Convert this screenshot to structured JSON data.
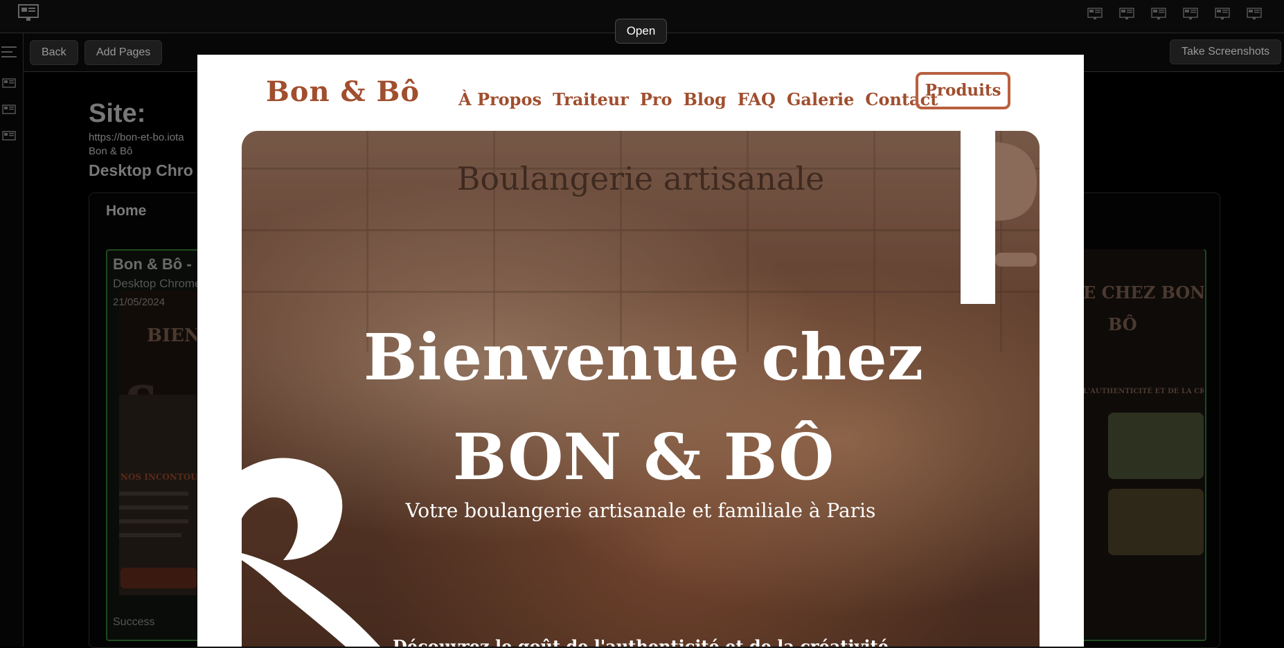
{
  "toolbar": {
    "back": "Back",
    "add_pages": "Add Pages",
    "take_screenshots": "Take Screenshots"
  },
  "site": {
    "heading": "Site:",
    "url": "https://bon-et-bo.iota",
    "name": "Bon & Bô",
    "device": "Desktop Chro"
  },
  "panel": {
    "title": "Home",
    "card": {
      "title": "Bon & Bô - ",
      "device": "Desktop Chrome",
      "date": "21/05/2024",
      "status": "Success"
    }
  },
  "open_button": "Open",
  "preview": {
    "logo": "Bon & Bô",
    "nav": [
      "À Propos",
      "Traiteur",
      "Pro",
      "Blog",
      "FAQ",
      "Galerie",
      "Contact"
    ],
    "cta": "Produits",
    "wall_sign": "Boulangerie artisanale",
    "hero_title": "Bienvenue chez BON & BÔ",
    "hero_subtitle": "Votre boulangerie artisanale et familiale à Paris",
    "hero_bottom": "Découvrez le goût de l'authenticité et de la créativité"
  },
  "colors": {
    "brand": "#a04e2e",
    "cta_border": "#b8603f",
    "background": "#000000"
  }
}
